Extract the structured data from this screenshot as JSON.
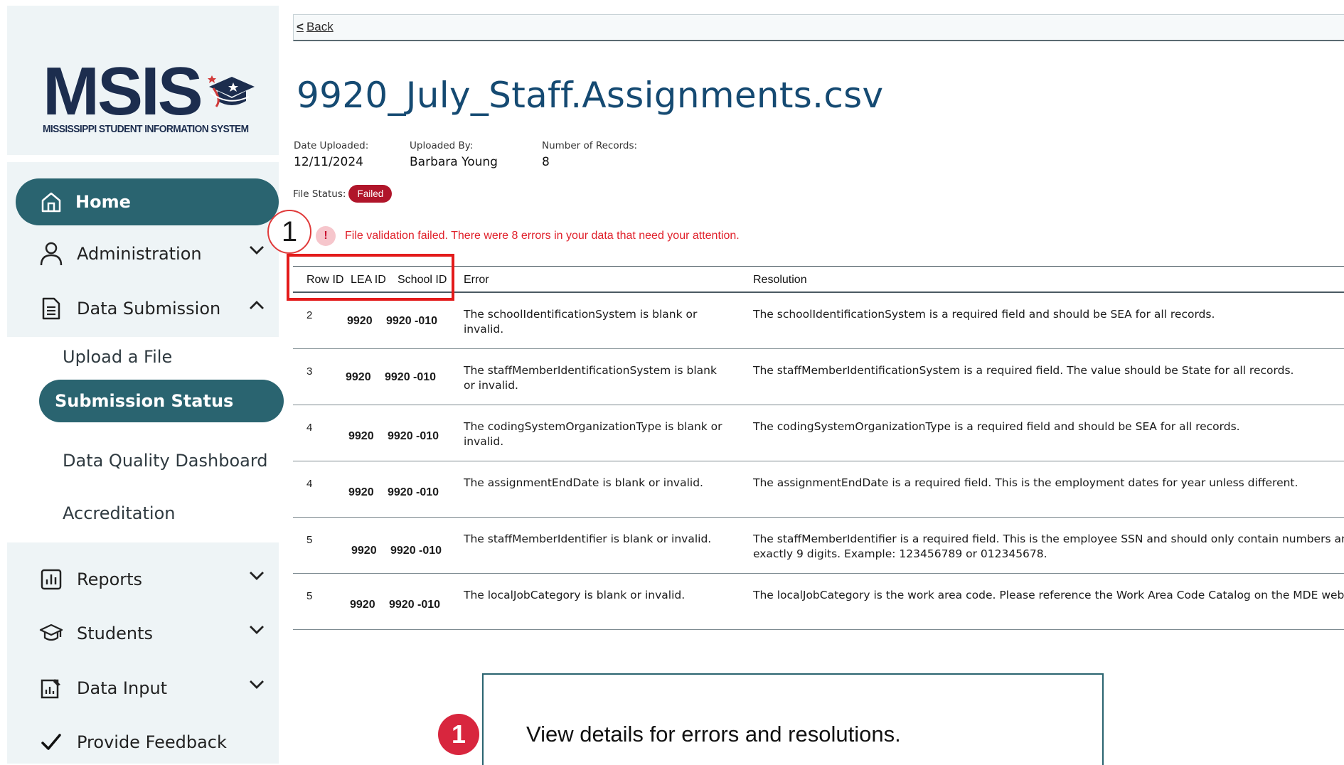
{
  "logo": {
    "main": "MSIS",
    "subtitle": "MISSISSIPPI STUDENT INFORMATION SYSTEM"
  },
  "nav": {
    "home": "Home",
    "administration": "Administration",
    "data_submission": "Data Submission",
    "upload_file": "Upload a File",
    "submission_status": "Submission Status",
    "data_quality_dashboard": "Data Quality Dashboard",
    "accreditation": "Accreditation",
    "reports": "Reports",
    "students": "Students",
    "data_input": "Data Input",
    "provide_feedback": "Provide Feedback"
  },
  "back": {
    "label": "Back"
  },
  "file": {
    "title": "9920_July_Staff.Assignments.csv",
    "date_uploaded_label": "Date Uploaded:",
    "date_uploaded": "12/11/2024",
    "uploaded_by_label": "Uploaded By:",
    "uploaded_by": "Barbara Young",
    "records_label": "Number of Records:",
    "records": "8",
    "status_label": "File Status:",
    "status": "Failed"
  },
  "alert": {
    "message": "File validation failed. There were 8 errors in your data that need your attention."
  },
  "callout_number": "1",
  "table": {
    "headers": {
      "row_id": "Row ID",
      "lea_id": "LEA ID",
      "school_id": "School ID",
      "error": "Error",
      "resolution": "Resolution"
    },
    "rows": [
      {
        "row_id": "2",
        "lea_id": "9920",
        "school_id": "9920 -010",
        "error_1": "The schoolIdentificationSystem is blank or",
        "error_2": "invalid.",
        "resolution_1": "The schoolIdentificationSystem is a required field and should be SEA for all records.",
        "resolution_2": ""
      },
      {
        "row_id": "3",
        "lea_id": "9920",
        "school_id": "9920 -010",
        "error_1": "The staffMemberIdentificationSystem is blank",
        "error_2": "or invalid.",
        "resolution_1": "The staffMemberIdentificationSystem is a required field. The value should be State for all records.",
        "resolution_2": ""
      },
      {
        "row_id": "4",
        "lea_id": "9920",
        "school_id": "9920 -010",
        "error_1": "The codingSystemOrganizationType is blank or",
        "error_2": "invalid.",
        "resolution_1": "The codingSystemOrganizationType is a required field and should be SEA for all records.",
        "resolution_2": ""
      },
      {
        "row_id": "4",
        "lea_id": "9920",
        "school_id": "9920 -010",
        "error_1": "The assignmentEndDate is blank or invalid.",
        "error_2": "",
        "resolution_1": "The assignmentEndDate is a required field. This is the employment dates for year unless different.",
        "resolution_2": ""
      },
      {
        "row_id": "5",
        "lea_id": "9920",
        "school_id": "9920 -010",
        "error_1": "The staffMemberIdentifier is blank or invalid.",
        "error_2": "",
        "resolution_1": "The staffMemberIdentifier is a required field. This is the employee SSN and should only contain numbers an",
        "resolution_2": "exactly 9 digits. Example: 123456789 or 012345678."
      },
      {
        "row_id": "5",
        "lea_id": "9920",
        "school_id": "9920 -010",
        "error_1": "The localJobCategory is blank or invalid.",
        "error_2": "",
        "resolution_1": "The localJobCategory is the work area code. Please reference the Work Area Code Catalog on the MDE web",
        "resolution_2": ""
      }
    ]
  },
  "tooltip": {
    "step": "1",
    "text": "View details for errors and resolutions."
  },
  "colors": {
    "teal": "#2a6470",
    "failed": "#b0152a",
    "error_text": "#e0202a",
    "title": "#154a72"
  }
}
